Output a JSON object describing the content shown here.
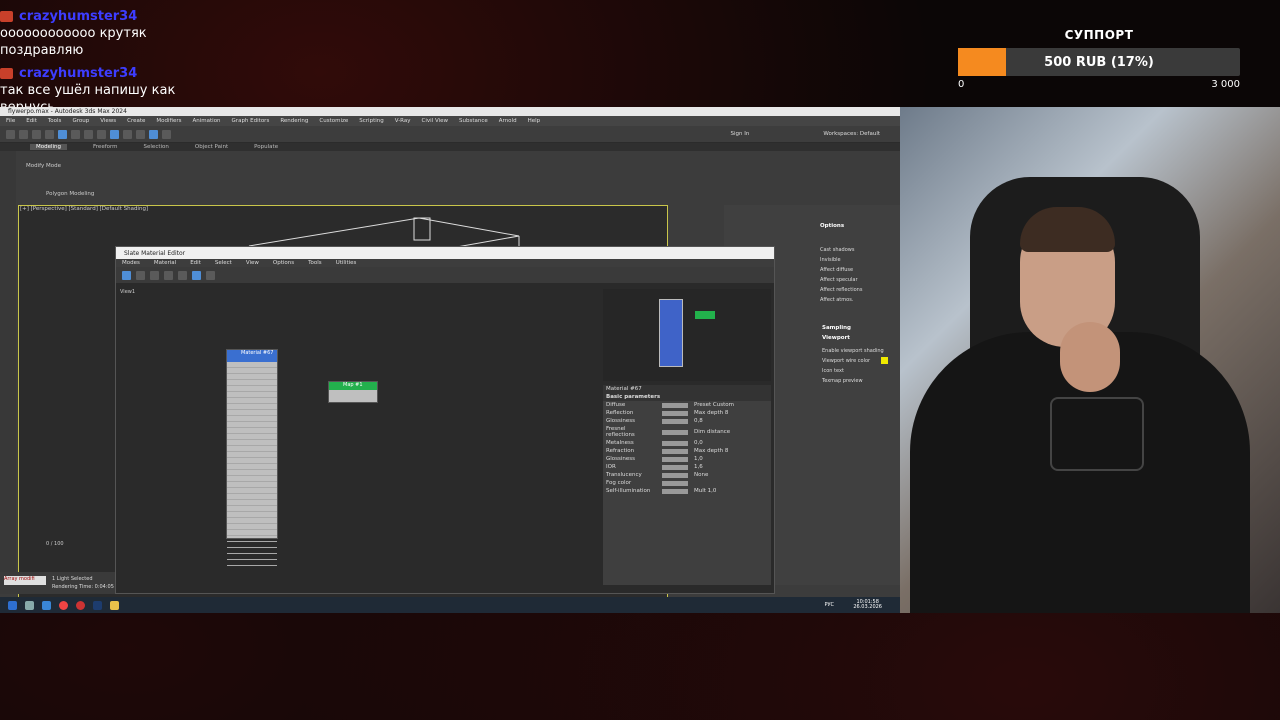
{
  "chat": {
    "messages": [
      {
        "user": "crazyhumster34",
        "text": "оооооооооооо крутяк поздравляю"
      },
      {
        "user": "crazyhumster34",
        "text": "так все ушёл напишу как вернусь"
      }
    ]
  },
  "support": {
    "title": "СУППОРТ",
    "amount": "500 RUB (17%)",
    "progress_fraction": 0.17,
    "min": "0",
    "max": "3 000"
  },
  "desktop": {
    "window_title": "flywerpo.max - Autodesk 3ds Max 2024",
    "menu": [
      "File",
      "Edit",
      "Tools",
      "Group",
      "Views",
      "Create",
      "Modifiers",
      "Animation",
      "Graph Editors",
      "Rendering",
      "Customize",
      "Scripting",
      "V-Ray",
      "Civil View",
      "Substance",
      "Arnold",
      "Help"
    ],
    "ribbon_tabs": [
      "Modeling",
      "Freeform",
      "Selection",
      "Object Paint",
      "Populate"
    ],
    "modify_mode": "Modify Mode",
    "polygon_modeling": "Polygon Modeling",
    "viewport_label": "[+] [Perspective] [Standard] [Default Shading]",
    "sign_in": "Sign In",
    "workspaces": "Workspaces: Default",
    "status_selected": "1 Light Selected",
    "rendering_time": "Rendering Time: 0:04:05",
    "array_label": "Array modifi",
    "frame_counter": "0 / 100",
    "clock_time": "10:01:58",
    "clock_date": "26.03.2026",
    "lang": "РУС"
  },
  "slate": {
    "title": "Slate Material Editor",
    "menu": [
      "Modes",
      "Material",
      "Edit",
      "Select",
      "View",
      "Options",
      "Tools",
      "Utilities"
    ],
    "view_tab": "View1",
    "node_main": "Material #67",
    "node_small": "Map #1",
    "material_name": "Material #67",
    "section": "Basic parameters",
    "params": [
      {
        "label": "Diffuse",
        "extra": "Preset  Custom"
      },
      {
        "label": "Reflection",
        "extra": "Max depth 8"
      },
      {
        "label": "Glossiness",
        "extra": "0,8"
      },
      {
        "label": "Fresnel reflections",
        "extra": "Dim distance"
      },
      {
        "label": "Metalness",
        "extra": "0,0"
      },
      {
        "label": "Refraction",
        "extra": "Max depth 8"
      },
      {
        "label": "Glossiness",
        "extra": "1,0"
      },
      {
        "label": "IOR",
        "extra": "1,6"
      },
      {
        "label": "Translucency",
        "extra": "None"
      },
      {
        "label": "Fog color",
        "extra": ""
      },
      {
        "label": "Self-illumination",
        "extra": "Mult 1,0"
      }
    ]
  },
  "command_panel": {
    "options_title": "Options",
    "items": [
      "Cast shadows",
      "Invisible",
      "Affect diffuse",
      "Affect specular",
      "Affect reflections",
      "Affect atmos."
    ],
    "sampling": "Sampling",
    "viewport": "Viewport",
    "vp_items": [
      "Enable viewport shading",
      "Viewport wire color",
      "Icon text",
      "Texmap preview"
    ]
  }
}
